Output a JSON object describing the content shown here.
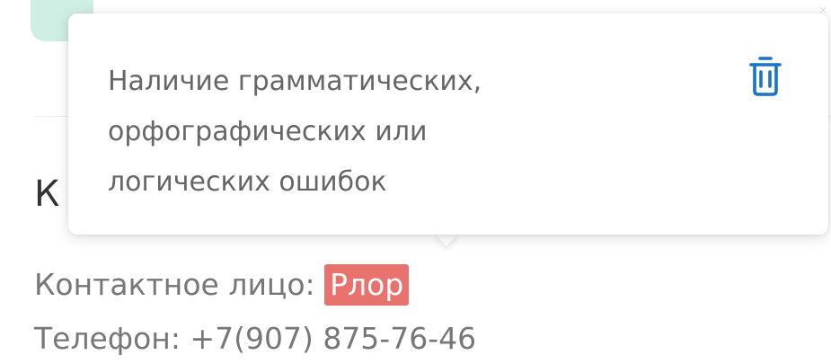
{
  "background": {
    "section_heading": "К",
    "contact_label": "Контактное лицо: ",
    "contact_value": "Рлор",
    "phone_line": "Телефон: +7(907) 875-76-46"
  },
  "popover": {
    "message_line_1": "Наличие грамматических,",
    "message_line_2": "орфографических или",
    "message_line_3": "логических ошибок",
    "delete_icon": "trash-icon"
  },
  "colors": {
    "highlight": "#e8736e",
    "icon_blue": "#1a73c8",
    "teal_accent": "#cfeee4"
  }
}
